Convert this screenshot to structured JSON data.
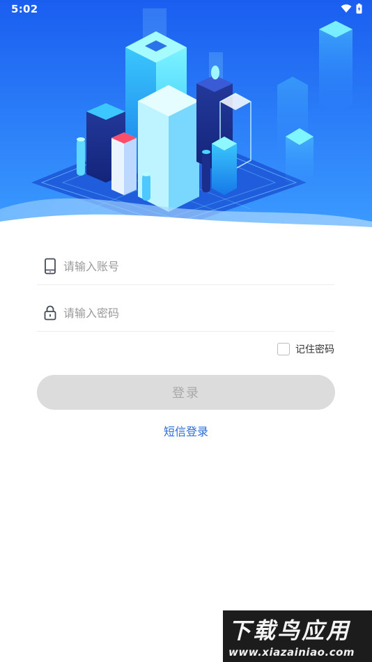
{
  "status_bar": {
    "time": "5:02",
    "icons": [
      "wifi-icon",
      "battery-charging-icon"
    ]
  },
  "hero": {
    "illustration": "isometric-city-illustration",
    "colors": {
      "gradient_top": "#1a5ef0",
      "gradient_bottom": "#3b9bff",
      "building_light": "#6ff0ff",
      "building_dark": "#1b2f8f"
    }
  },
  "login_form": {
    "account_placeholder": "请输入账号",
    "account_value": "",
    "password_placeholder": "请输入密码",
    "password_value": "",
    "remember_label": "记住密码",
    "remember_checked": false,
    "login_button_label": "登录",
    "sms_login_label": "短信登录"
  },
  "colors": {
    "link": "#2b6bd6",
    "button_disabled_bg": "#dcdcdc",
    "button_disabled_text": "#a9a9a9"
  },
  "watermark": {
    "title": "下载鸟应用",
    "url": "www.xiazainiao.com"
  }
}
